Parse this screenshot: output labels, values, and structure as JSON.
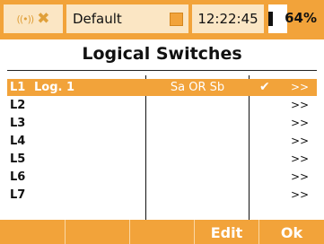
{
  "status": {
    "model_name": "Default",
    "time": "12:22:45",
    "battery_percent_label": "64%",
    "battery_level": 0.64
  },
  "title": "Logical Switches",
  "rows": [
    {
      "id": "L1",
      "name": "Log. 1",
      "condition": "Sa OR Sb",
      "active": "✔",
      "arrow": ">>",
      "selected": true
    },
    {
      "id": "L2",
      "name": "",
      "condition": "",
      "active": "",
      "arrow": ">>",
      "selected": false
    },
    {
      "id": "L3",
      "name": "",
      "condition": "",
      "active": "",
      "arrow": ">>",
      "selected": false
    },
    {
      "id": "L4",
      "name": "",
      "condition": "",
      "active": "",
      "arrow": ">>",
      "selected": false
    },
    {
      "id": "L5",
      "name": "",
      "condition": "",
      "active": "",
      "arrow": ">>",
      "selected": false
    },
    {
      "id": "L6",
      "name": "",
      "condition": "",
      "active": "",
      "arrow": ">>",
      "selected": false
    },
    {
      "id": "L7",
      "name": "",
      "condition": "",
      "active": "",
      "arrow": ">>",
      "selected": false
    }
  ],
  "buttons": {
    "f1": "",
    "f2": "",
    "f3": "",
    "f4": "Edit",
    "f5": "Ok"
  },
  "colors": {
    "accent": "#f2a33a",
    "cell_background": "#fbe6c4"
  },
  "icons": {
    "signal": "signal-waves-icon",
    "disconnected": "x-icon",
    "battery": "battery-icon"
  }
}
